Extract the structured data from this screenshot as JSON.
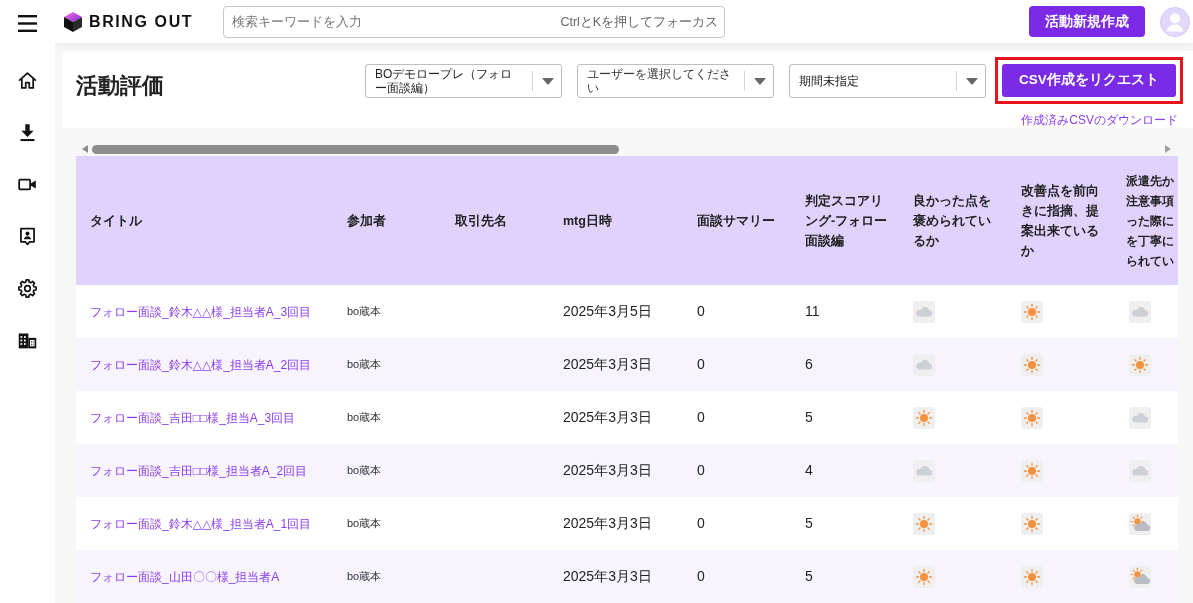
{
  "topbar": {
    "logo": "BRING OUT",
    "search": {
      "placeholder": "検索キーワードを入力",
      "shortcut_hint": "CtrlとKを押してフォーカス"
    },
    "create_button": "活動新規作成"
  },
  "page": {
    "title": "活動評価",
    "filters": [
      {
        "value": "BOデモロープレ（フォロー面談編）"
      },
      {
        "placeholder": "ユーザーを選択してください"
      },
      {
        "value": "期間未指定"
      }
    ],
    "csv_button": {
      "label": "CSV作成をリクエスト",
      "highlighted": true
    },
    "download_link": "作成済みCSVのダウンロード"
  },
  "table": {
    "columns": [
      "タイトル",
      "参加者",
      "取引先名",
      "mtg日時",
      "面談サマリー",
      "判定スコアリング-フォロー面談編",
      "良かった点を褒められているか",
      "改善点を前向きに指摘、提案出来ているか",
      "派遣先か注意事項った際にを丁寧にられてい"
    ],
    "rows": [
      {
        "title": "フォロー面談_鈴木△△様_担当者A_3回目",
        "participant": "bo蔵本",
        "date": "2025年3月5日",
        "summary": "0",
        "score": "11",
        "ratings": [
          {
            "kind": "cloudy"
          },
          {
            "kind": "sunny"
          },
          {
            "kind": "cloudy"
          }
        ]
      },
      {
        "title": "フォロー面談_鈴木△△様_担当者A_2回目",
        "participant": "bo蔵本",
        "date": "2025年3月3日",
        "summary": "0",
        "score": "6",
        "ratings": [
          {
            "kind": "cloudy"
          },
          {
            "kind": "sunny"
          },
          {
            "kind": "sunny"
          }
        ]
      },
      {
        "title": "フォロー面談_吉田□□様_担当A_3回目",
        "participant": "bo蔵本",
        "date": "2025年3月3日",
        "summary": "0",
        "score": "5",
        "ratings": [
          {
            "kind": "sunny"
          },
          {
            "kind": "sunny"
          },
          {
            "kind": "cloudy"
          }
        ]
      },
      {
        "title": "フォロー面談_吉田□□様_担当者A_2回目",
        "participant": "bo蔵本",
        "date": "2025年3月3日",
        "summary": "0",
        "score": "4",
        "ratings": [
          {
            "kind": "cloudy"
          },
          {
            "kind": "sunny"
          },
          {
            "kind": "cloudy"
          }
        ]
      },
      {
        "title": "フォロー面談_鈴木△△様_担当者A_1回目",
        "participant": "bo蔵本",
        "date": "2025年3月3日",
        "summary": "0",
        "score": "5",
        "ratings": [
          {
            "kind": "sunny"
          },
          {
            "kind": "sunny"
          },
          {
            "kind": "partly_cloudy"
          }
        ]
      },
      {
        "title": "フォロー面談_山田〇〇様_担当者A",
        "participant": "bo蔵本",
        "date": "2025年3月3日",
        "summary": "0",
        "score": "5",
        "ratings": [
          {
            "kind": "sunny"
          },
          {
            "kind": "sunny"
          },
          {
            "kind": "partly_cloudy"
          }
        ]
      }
    ]
  }
}
